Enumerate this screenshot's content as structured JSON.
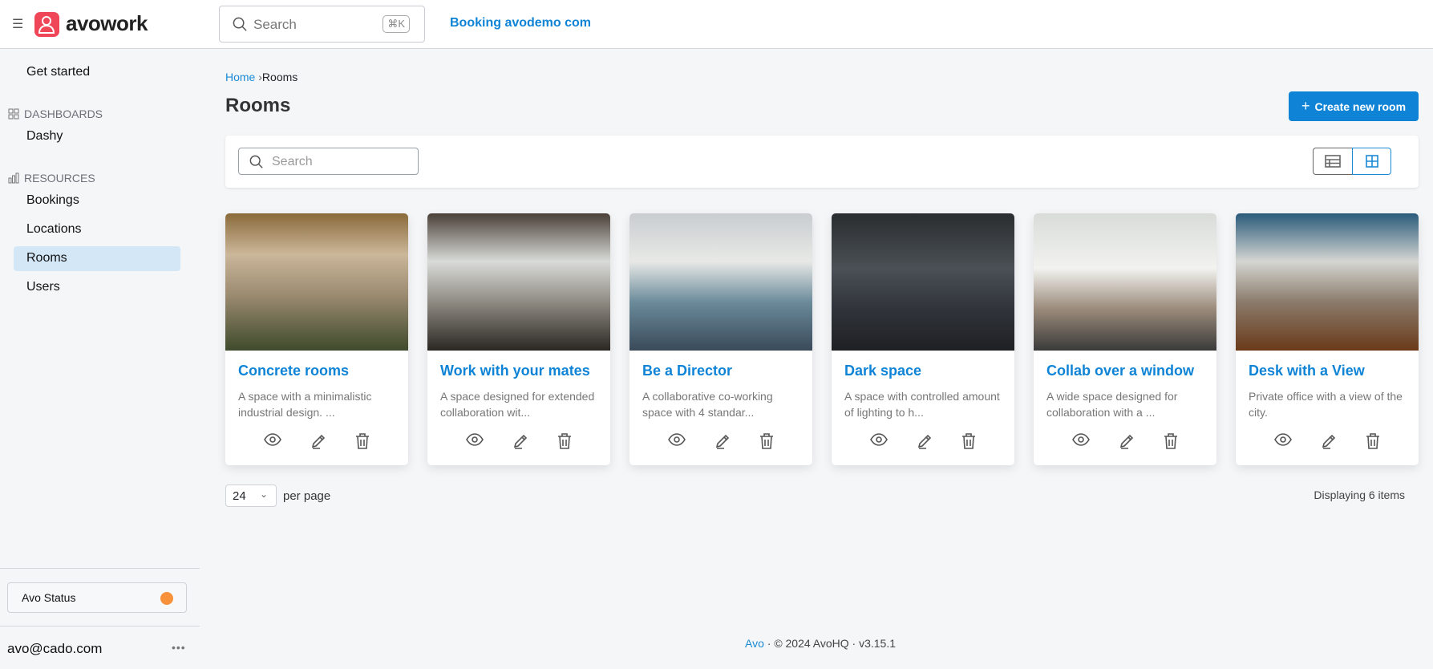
{
  "header": {
    "brand": "avowork",
    "search_placeholder": "Search",
    "shortcut": "⌘K",
    "app_link": "Booking avodemo com"
  },
  "sidebar": {
    "get_started": "Get started",
    "dashboards_heading": "DASHBOARDS",
    "dashboards": [
      "Dashy"
    ],
    "resources_heading": "RESOURCES",
    "resources": [
      "Bookings",
      "Locations",
      "Rooms",
      "Users"
    ],
    "active": "Rooms",
    "status_label": "Avo Status",
    "status_color": "#f7923a",
    "user_email": "avo@cado.com",
    "more": "•••"
  },
  "breadcrumb": {
    "home": "Home",
    "separator": "›",
    "current": "Rooms"
  },
  "page": {
    "title": "Rooms",
    "create_button": "Create new room",
    "search_placeholder": "Search"
  },
  "cards": [
    {
      "title": "Concrete rooms",
      "description": "A space with a minimalistic industrial design. ..."
    },
    {
      "title": "Work with your mates",
      "description": "A space designed for extended collaboration wit..."
    },
    {
      "title": "Be a Director",
      "description": "A collaborative co-working space with 4 standar..."
    },
    {
      "title": "Dark space",
      "description": "A space with controlled amount of lighting to h..."
    },
    {
      "title": "Collab over a window",
      "description": "A wide space designed for collaboration with a ..."
    },
    {
      "title": "Desk with a View",
      "description": "Private office with a view of the city."
    }
  ],
  "pagination": {
    "per_page_value": "24",
    "per_page_label": "per page",
    "displaying": "Displaying 6 items"
  },
  "footer": {
    "link": "Avo",
    "text": " · © 2024 AvoHQ · v3.15.1"
  }
}
